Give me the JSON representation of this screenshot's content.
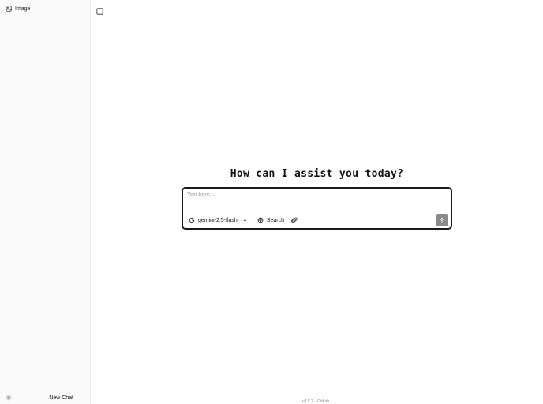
{
  "sidebar": {
    "items": [
      {
        "label": "Image",
        "icon": "image-icon"
      }
    ],
    "new_chat_label": "New Chat",
    "settings_icon": "gear-icon",
    "plus_icon": "plus-icon"
  },
  "header": {
    "toggle_icon": "sidebar-toggle-icon"
  },
  "main": {
    "heading": "How can I assist you today?",
    "composer": {
      "placeholder": "Text here...",
      "model": "gemini-2.5-flash",
      "search_label": "Search",
      "send_icon": "arrow-up-icon"
    }
  },
  "footer": {
    "version": "v4.5.2",
    "separator": "·",
    "link": "Github"
  },
  "colors": {
    "sidebar_bg": "#fafafa",
    "composer_border": "#1a1a1a",
    "send_button": "#8b8b8b"
  }
}
